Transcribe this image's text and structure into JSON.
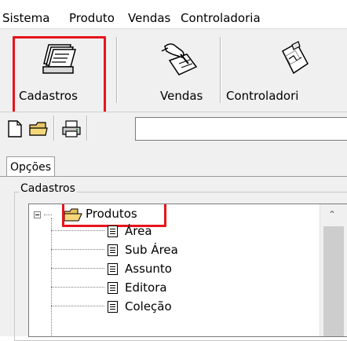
{
  "menu": [
    "Sistema",
    "Produto",
    "Vendas",
    "Controladoria"
  ],
  "toolbar": {
    "buttons": [
      {
        "label": "Cadastros",
        "icon": "card-file-icon",
        "highlighted": true
      },
      {
        "label": "Vendas",
        "icon": "hand-writing-icon"
      },
      {
        "label": "Controladori",
        "icon": "clipboard-chart-icon"
      }
    ]
  },
  "small_toolbar": {
    "icons": [
      "new-document-icon",
      "open-folder-icon",
      "printer-icon"
    ],
    "input_value": ""
  },
  "tabs": [
    "Opções"
  ],
  "group_label": "Cadastros",
  "tree": {
    "root": {
      "label": "Produtos",
      "icon": "folder-open-icon",
      "highlighted": true
    },
    "children": [
      "Área",
      "Sub Área",
      "Assunto",
      "Editora",
      "Coleção"
    ]
  },
  "colors": {
    "highlight": "#e8141c",
    "toolbar_bg": "#f0f0f0"
  }
}
